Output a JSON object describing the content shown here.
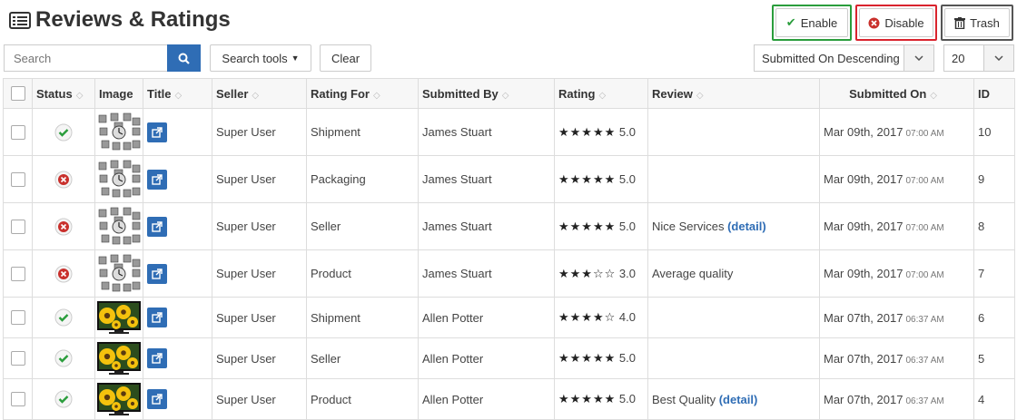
{
  "page_title": "Reviews & Ratings",
  "actions": {
    "enable": "Enable",
    "disable": "Disable",
    "trash": "Trash"
  },
  "toolbar": {
    "search_placeholder": "Search",
    "search_tools": "Search tools",
    "clear": "Clear",
    "sort_value": "Submitted On Descending",
    "page_size": "20"
  },
  "columns": [
    "Status",
    "Image",
    "Title",
    "Seller",
    "Rating For",
    "Submitted By",
    "Rating",
    "Review",
    "Submitted On",
    "ID"
  ],
  "rows": [
    {
      "status": "enabled",
      "image": "clock",
      "seller": "Super User",
      "rating_for": "Shipment",
      "submitted_by": "James Stuart",
      "stars": "★★★★★",
      "rating": "5.0",
      "review": "",
      "detail": "",
      "date": "Mar 09th, 2017",
      "time": "07:00 AM",
      "id": "10"
    },
    {
      "status": "disabled",
      "image": "clock",
      "seller": "Super User",
      "rating_for": "Packaging",
      "submitted_by": "James Stuart",
      "stars": "★★★★★",
      "rating": "5.0",
      "review": "",
      "detail": "",
      "date": "Mar 09th, 2017",
      "time": "07:00 AM",
      "id": "9"
    },
    {
      "status": "disabled",
      "image": "clock",
      "seller": "Super User",
      "rating_for": "Seller",
      "submitted_by": "James Stuart",
      "stars": "★★★★★",
      "rating": "5.0",
      "review": "Nice Services",
      "detail": "(detail)",
      "date": "Mar 09th, 2017",
      "time": "07:00 AM",
      "id": "8"
    },
    {
      "status": "disabled",
      "image": "clock",
      "seller": "Super User",
      "rating_for": "Product",
      "submitted_by": "James Stuart",
      "stars": "★★★☆☆",
      "rating": "3.0",
      "review": "Average quality",
      "detail": "",
      "date": "Mar 09th, 2017",
      "time": "07:00 AM",
      "id": "7"
    },
    {
      "status": "enabled",
      "image": "tv",
      "seller": "Super User",
      "rating_for": "Shipment",
      "submitted_by": "Allen Potter",
      "stars": "★★★★☆",
      "rating": "4.0",
      "review": "",
      "detail": "",
      "date": "Mar 07th, 2017",
      "time": "06:37 AM",
      "id": "6"
    },
    {
      "status": "enabled",
      "image": "tv",
      "seller": "Super User",
      "rating_for": "Seller",
      "submitted_by": "Allen Potter",
      "stars": "★★★★★",
      "rating": "5.0",
      "review": "",
      "detail": "",
      "date": "Mar 07th, 2017",
      "time": "06:37 AM",
      "id": "5"
    },
    {
      "status": "enabled",
      "image": "tv",
      "seller": "Super User",
      "rating_for": "Product",
      "submitted_by": "Allen Potter",
      "stars": "★★★★★",
      "rating": "5.0",
      "review": "Best Quality",
      "detail": "(detail)",
      "date": "Mar 07th, 2017",
      "time": "06:37 AM",
      "id": "4"
    }
  ],
  "colors": {
    "enable_border": "#2a9d3c",
    "disable_border": "#d9232d",
    "primary": "#2f6db5",
    "check": "#2a9d3c",
    "cross": "#c9302c"
  }
}
